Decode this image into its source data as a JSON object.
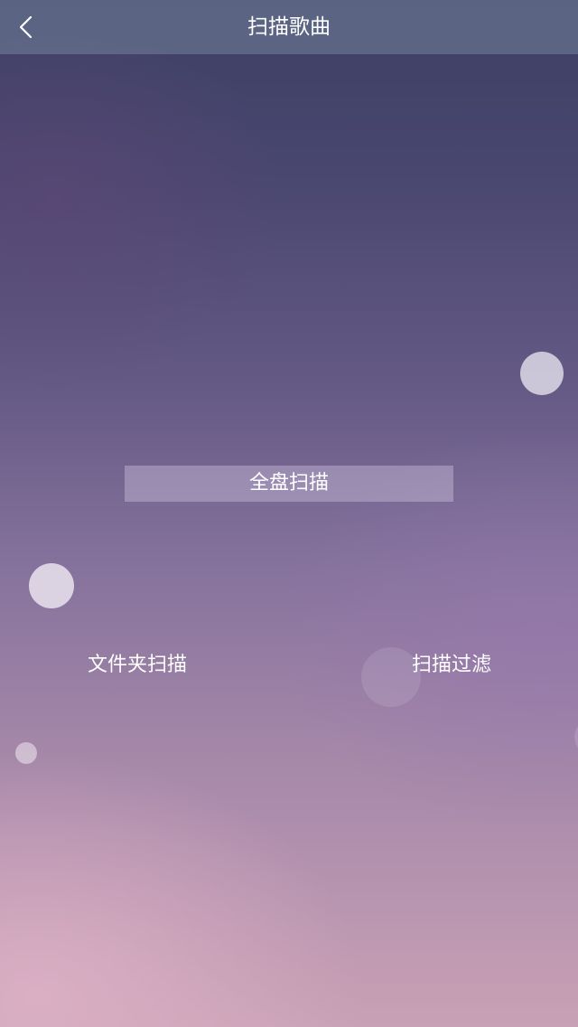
{
  "header": {
    "title": "扫描歌曲",
    "back_icon": "chevron-left-icon"
  },
  "main": {
    "full_scan_label": "全盘扫描",
    "folder_scan_label": "文件夹扫描",
    "scan_filter_label": "扫描过滤"
  },
  "colors": {
    "header_bg": "#6e7a96",
    "text": "#ffffff",
    "bg_top": "#3c3f63",
    "bg_bottom": "#c9a1b5"
  }
}
